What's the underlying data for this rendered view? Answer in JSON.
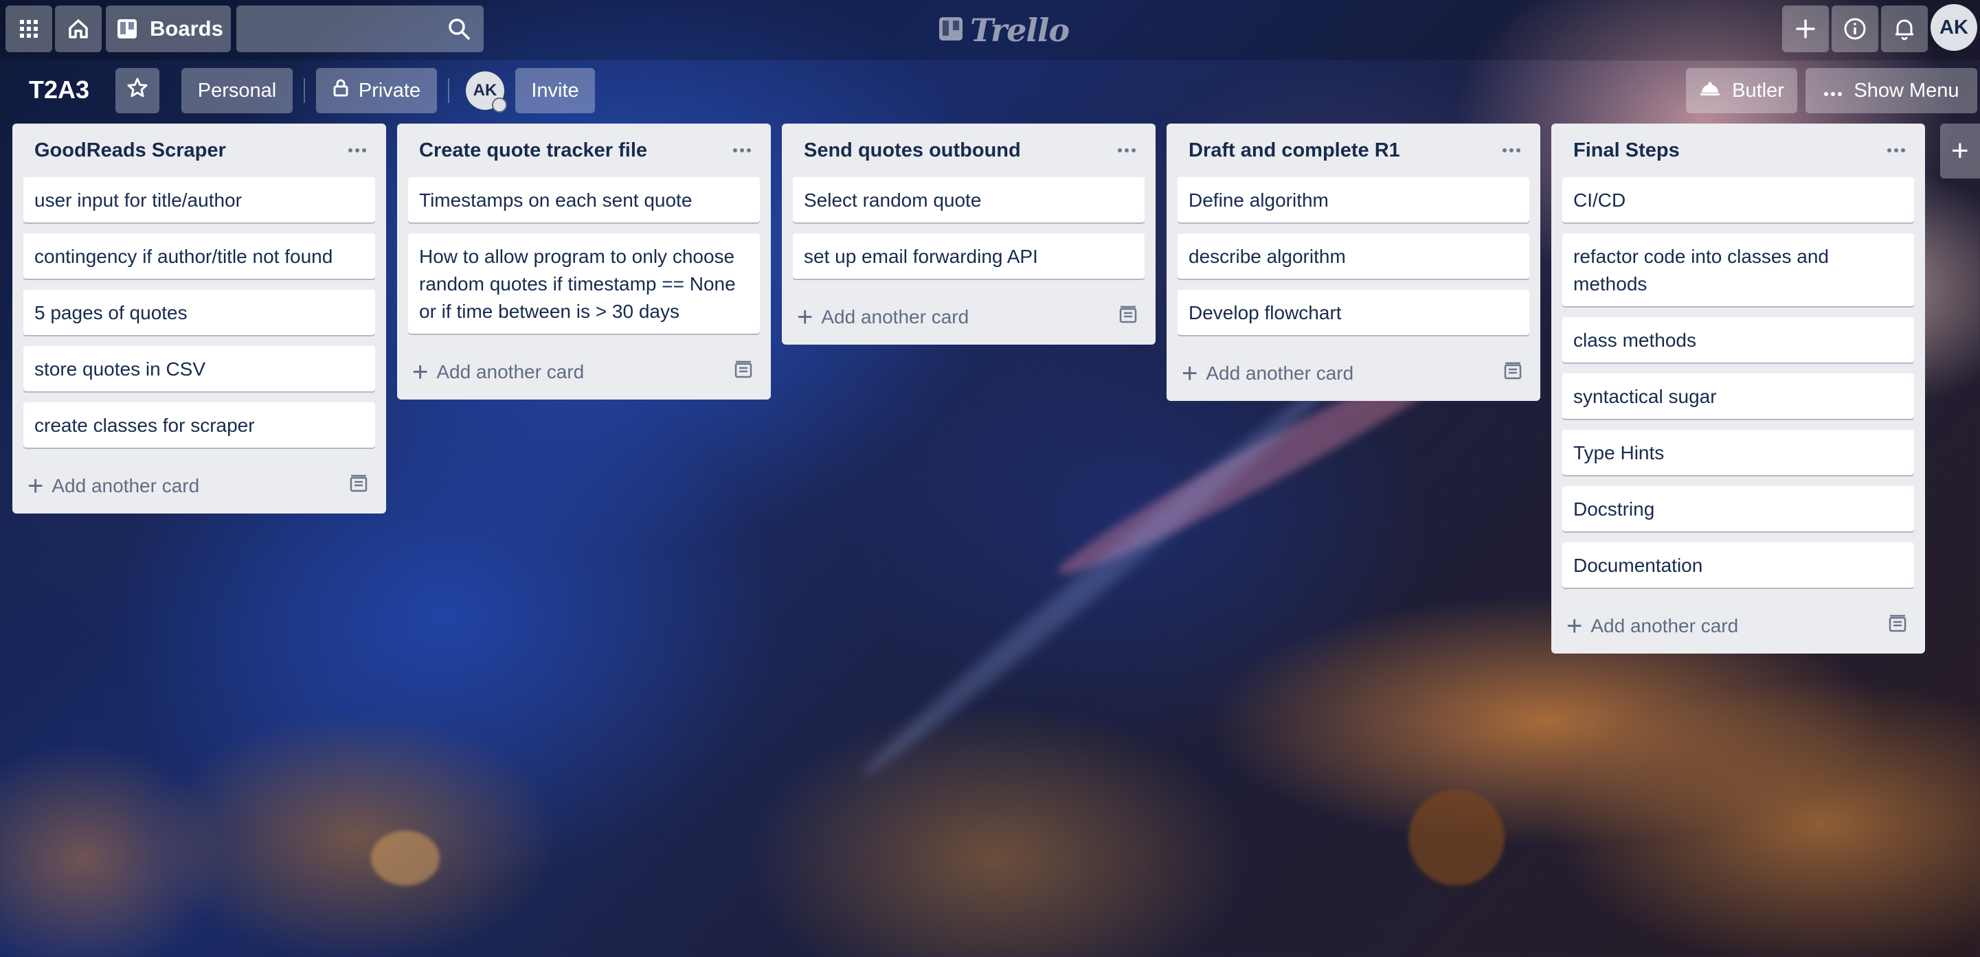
{
  "app": {
    "logo_text": "Trello",
    "boards_label": "Boards",
    "user_initials": "AK"
  },
  "board": {
    "title": "T2A3",
    "team_label": "Personal",
    "visibility_label": "Private",
    "member_initials": "AK",
    "invite_label": "Invite",
    "butler_label": "Butler",
    "show_menu_label": "Show Menu"
  },
  "add_card_label": "Add another card",
  "lists": [
    {
      "title": "GoodReads Scraper",
      "cards": [
        "user input for title/author",
        "contingency if author/title not found",
        "5 pages of quotes",
        "store quotes in CSV",
        "create classes for scraper"
      ]
    },
    {
      "title": "Create quote tracker file",
      "cards": [
        "Timestamps on each sent quote",
        "How to allow program to only choose random quotes if timestamp == None or if time between is > 30 days"
      ]
    },
    {
      "title": "Send quotes outbound",
      "cards": [
        "Select random quote",
        "set up email forwarding API"
      ]
    },
    {
      "title": "Draft and complete R1",
      "cards": [
        "Define algorithm",
        "describe algorithm",
        "Develop flowchart"
      ]
    },
    {
      "title": "Final Steps",
      "cards": [
        "CI/CD",
        "refactor code into classes and methods",
        "class methods",
        "syntactical sugar",
        "Type Hints",
        "Docstring",
        "Documentation"
      ]
    }
  ]
}
